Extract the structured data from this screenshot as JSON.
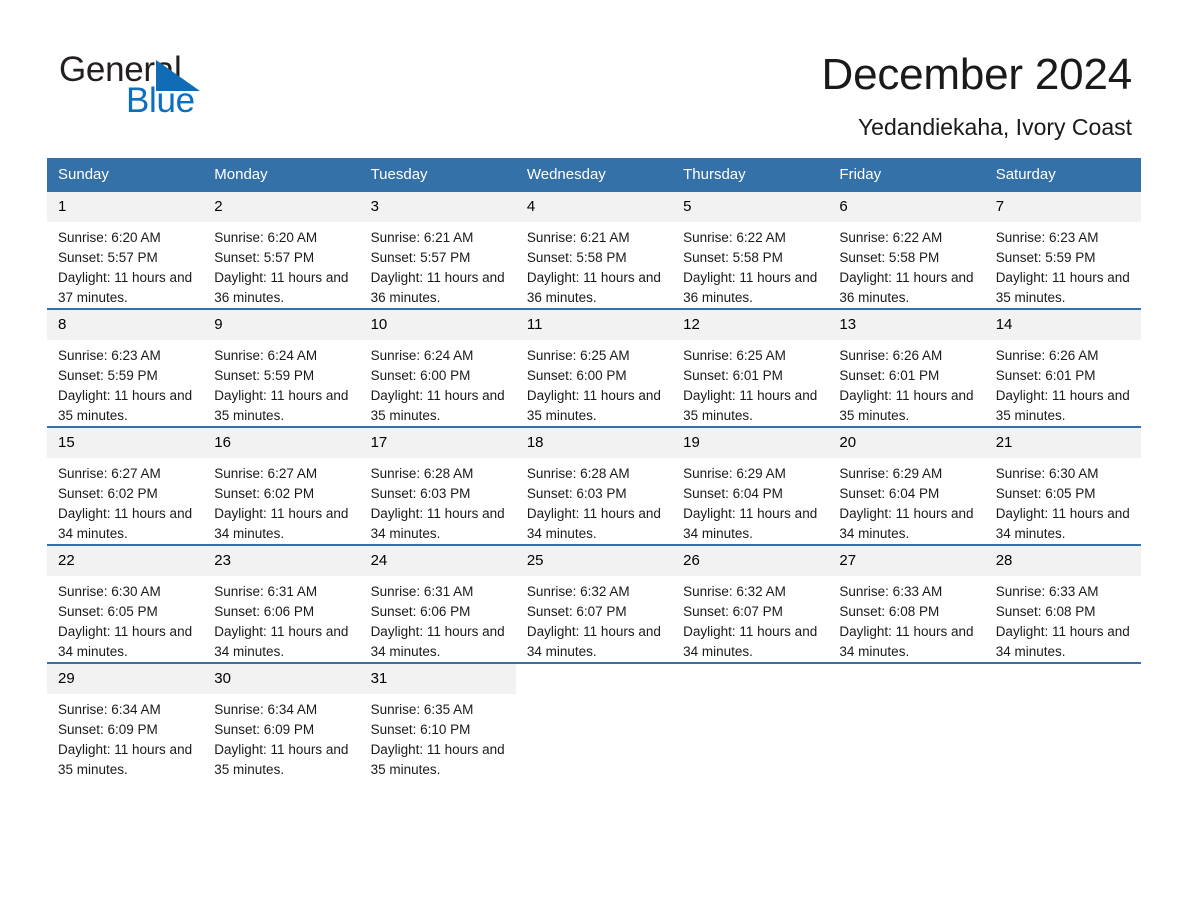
{
  "brand": {
    "name_part1": "General",
    "name_part2": "Blue",
    "triangle_icon": "triangle-icon",
    "accent_color": "#0d6fc0"
  },
  "header": {
    "title": "December 2024",
    "subtitle": "Yedandiekaha, Ivory Coast"
  },
  "colors": {
    "header_blue": "#3571a9",
    "daynum_bg": "#f2f2f2",
    "text": "#1a1a1a"
  },
  "calendar": {
    "weekdays": [
      "Sunday",
      "Monday",
      "Tuesday",
      "Wednesday",
      "Thursday",
      "Friday",
      "Saturday"
    ],
    "weeks": [
      [
        {
          "day": "1",
          "sunrise": "Sunrise: 6:20 AM",
          "sunset": "Sunset: 5:57 PM",
          "daylight": "Daylight: 11 hours and 37 minutes."
        },
        {
          "day": "2",
          "sunrise": "Sunrise: 6:20 AM",
          "sunset": "Sunset: 5:57 PM",
          "daylight": "Daylight: 11 hours and 36 minutes."
        },
        {
          "day": "3",
          "sunrise": "Sunrise: 6:21 AM",
          "sunset": "Sunset: 5:57 PM",
          "daylight": "Daylight: 11 hours and 36 minutes."
        },
        {
          "day": "4",
          "sunrise": "Sunrise: 6:21 AM",
          "sunset": "Sunset: 5:58 PM",
          "daylight": "Daylight: 11 hours and 36 minutes."
        },
        {
          "day": "5",
          "sunrise": "Sunrise: 6:22 AM",
          "sunset": "Sunset: 5:58 PM",
          "daylight": "Daylight: 11 hours and 36 minutes."
        },
        {
          "day": "6",
          "sunrise": "Sunrise: 6:22 AM",
          "sunset": "Sunset: 5:58 PM",
          "daylight": "Daylight: 11 hours and 36 minutes."
        },
        {
          "day": "7",
          "sunrise": "Sunrise: 6:23 AM",
          "sunset": "Sunset: 5:59 PM",
          "daylight": "Daylight: 11 hours and 35 minutes."
        }
      ],
      [
        {
          "day": "8",
          "sunrise": "Sunrise: 6:23 AM",
          "sunset": "Sunset: 5:59 PM",
          "daylight": "Daylight: 11 hours and 35 minutes."
        },
        {
          "day": "9",
          "sunrise": "Sunrise: 6:24 AM",
          "sunset": "Sunset: 5:59 PM",
          "daylight": "Daylight: 11 hours and 35 minutes."
        },
        {
          "day": "10",
          "sunrise": "Sunrise: 6:24 AM",
          "sunset": "Sunset: 6:00 PM",
          "daylight": "Daylight: 11 hours and 35 minutes."
        },
        {
          "day": "11",
          "sunrise": "Sunrise: 6:25 AM",
          "sunset": "Sunset: 6:00 PM",
          "daylight": "Daylight: 11 hours and 35 minutes."
        },
        {
          "day": "12",
          "sunrise": "Sunrise: 6:25 AM",
          "sunset": "Sunset: 6:01 PM",
          "daylight": "Daylight: 11 hours and 35 minutes."
        },
        {
          "day": "13",
          "sunrise": "Sunrise: 6:26 AM",
          "sunset": "Sunset: 6:01 PM",
          "daylight": "Daylight: 11 hours and 35 minutes."
        },
        {
          "day": "14",
          "sunrise": "Sunrise: 6:26 AM",
          "sunset": "Sunset: 6:01 PM",
          "daylight": "Daylight: 11 hours and 35 minutes."
        }
      ],
      [
        {
          "day": "15",
          "sunrise": "Sunrise: 6:27 AM",
          "sunset": "Sunset: 6:02 PM",
          "daylight": "Daylight: 11 hours and 34 minutes."
        },
        {
          "day": "16",
          "sunrise": "Sunrise: 6:27 AM",
          "sunset": "Sunset: 6:02 PM",
          "daylight": "Daylight: 11 hours and 34 minutes."
        },
        {
          "day": "17",
          "sunrise": "Sunrise: 6:28 AM",
          "sunset": "Sunset: 6:03 PM",
          "daylight": "Daylight: 11 hours and 34 minutes."
        },
        {
          "day": "18",
          "sunrise": "Sunrise: 6:28 AM",
          "sunset": "Sunset: 6:03 PM",
          "daylight": "Daylight: 11 hours and 34 minutes."
        },
        {
          "day": "19",
          "sunrise": "Sunrise: 6:29 AM",
          "sunset": "Sunset: 6:04 PM",
          "daylight": "Daylight: 11 hours and 34 minutes."
        },
        {
          "day": "20",
          "sunrise": "Sunrise: 6:29 AM",
          "sunset": "Sunset: 6:04 PM",
          "daylight": "Daylight: 11 hours and 34 minutes."
        },
        {
          "day": "21",
          "sunrise": "Sunrise: 6:30 AM",
          "sunset": "Sunset: 6:05 PM",
          "daylight": "Daylight: 11 hours and 34 minutes."
        }
      ],
      [
        {
          "day": "22",
          "sunrise": "Sunrise: 6:30 AM",
          "sunset": "Sunset: 6:05 PM",
          "daylight": "Daylight: 11 hours and 34 minutes."
        },
        {
          "day": "23",
          "sunrise": "Sunrise: 6:31 AM",
          "sunset": "Sunset: 6:06 PM",
          "daylight": "Daylight: 11 hours and 34 minutes."
        },
        {
          "day": "24",
          "sunrise": "Sunrise: 6:31 AM",
          "sunset": "Sunset: 6:06 PM",
          "daylight": "Daylight: 11 hours and 34 minutes."
        },
        {
          "day": "25",
          "sunrise": "Sunrise: 6:32 AM",
          "sunset": "Sunset: 6:07 PM",
          "daylight": "Daylight: 11 hours and 34 minutes."
        },
        {
          "day": "26",
          "sunrise": "Sunrise: 6:32 AM",
          "sunset": "Sunset: 6:07 PM",
          "daylight": "Daylight: 11 hours and 34 minutes."
        },
        {
          "day": "27",
          "sunrise": "Sunrise: 6:33 AM",
          "sunset": "Sunset: 6:08 PM",
          "daylight": "Daylight: 11 hours and 34 minutes."
        },
        {
          "day": "28",
          "sunrise": "Sunrise: 6:33 AM",
          "sunset": "Sunset: 6:08 PM",
          "daylight": "Daylight: 11 hours and 34 minutes."
        }
      ],
      [
        {
          "day": "29",
          "sunrise": "Sunrise: 6:34 AM",
          "sunset": "Sunset: 6:09 PM",
          "daylight": "Daylight: 11 hours and 35 minutes."
        },
        {
          "day": "30",
          "sunrise": "Sunrise: 6:34 AM",
          "sunset": "Sunset: 6:09 PM",
          "daylight": "Daylight: 11 hours and 35 minutes."
        },
        {
          "day": "31",
          "sunrise": "Sunrise: 6:35 AM",
          "sunset": "Sunset: 6:10 PM",
          "daylight": "Daylight: 11 hours and 35 minutes."
        },
        {
          "day": "",
          "sunrise": "",
          "sunset": "",
          "daylight": ""
        },
        {
          "day": "",
          "sunrise": "",
          "sunset": "",
          "daylight": ""
        },
        {
          "day": "",
          "sunrise": "",
          "sunset": "",
          "daylight": ""
        },
        {
          "day": "",
          "sunrise": "",
          "sunset": "",
          "daylight": ""
        }
      ]
    ]
  }
}
